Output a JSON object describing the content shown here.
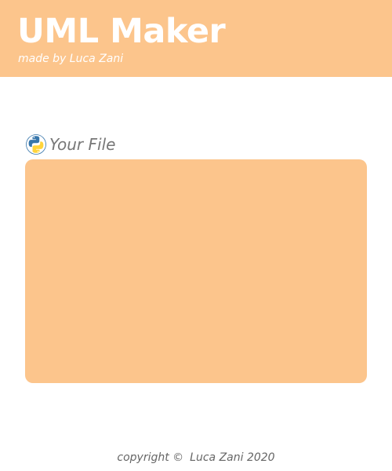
{
  "header": {
    "title": "UML Maker",
    "subtitle": "made by Luca Zani",
    "background_color": "#fcc58c"
  },
  "file_section": {
    "icon": "python-icon",
    "label": "Your File",
    "drop_area_color": "#fcc58c"
  },
  "footer": {
    "copyright_prefix": "copyright ©",
    "copyright_owner": "Luca Zani 2020"
  }
}
